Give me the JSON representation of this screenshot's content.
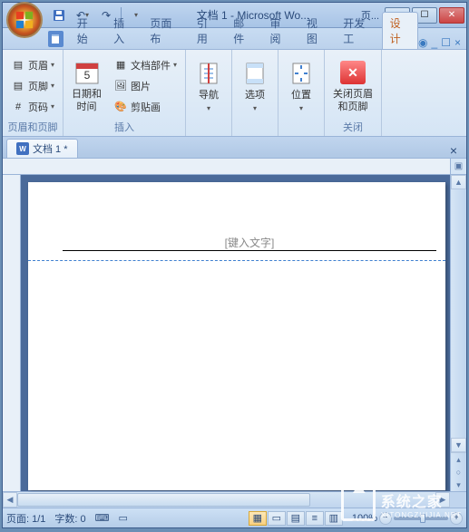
{
  "titlebar": {
    "title": "文档 1 - Microsoft Wo...",
    "context": "页..."
  },
  "tabs": {
    "t0": "开始",
    "t1": "插入",
    "t2": "页面布",
    "t3": "引用",
    "t4": "邮件",
    "t5": "审阅",
    "t6": "视图",
    "t7": "开发工",
    "t8": "设计"
  },
  "ribbon": {
    "g1": {
      "label": "页眉和页脚",
      "header": "页眉",
      "footer": "页脚",
      "pagenum": "页码"
    },
    "g2": {
      "label": "插入",
      "datetime": "日期和\n时间",
      "parts": "文档部件",
      "picture": "图片",
      "clipart": "剪贴画"
    },
    "g3": {
      "nav": "导航"
    },
    "g4": {
      "options": "选项"
    },
    "g5": {
      "position": "位置"
    },
    "g6": {
      "label": "关闭",
      "close": "关闭页眉\n和页脚"
    }
  },
  "doc": {
    "tab_label": "文档 1 *",
    "placeholder": "[键入文字]"
  },
  "status": {
    "page": "页面: 1/1",
    "words": "字数: 0",
    "zoom": "100%"
  },
  "watermark": {
    "main": "系统之家",
    "sub": "XITONGZHIJIA.NET"
  }
}
